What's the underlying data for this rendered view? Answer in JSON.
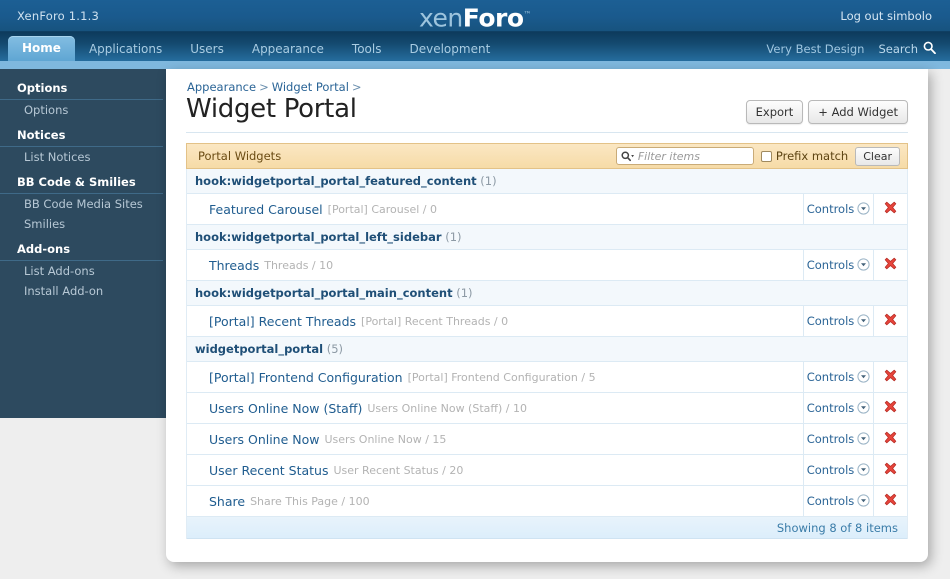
{
  "topbar": {
    "version": "XenForo 1.1.3",
    "logo_light": "xen",
    "logo_bold": "Foro",
    "logo_tm": "™",
    "logout": "Log out simbolo"
  },
  "nav": {
    "tabs": [
      {
        "label": "Home",
        "active": true
      },
      {
        "label": "Applications",
        "active": false
      },
      {
        "label": "Users",
        "active": false
      },
      {
        "label": "Appearance",
        "active": false
      },
      {
        "label": "Tools",
        "active": false
      },
      {
        "label": "Development",
        "active": false
      }
    ],
    "style_link": "Very Best Design",
    "search_label": "Search",
    "search_icon": "search-icon"
  },
  "sidebar": {
    "groups": [
      {
        "header": "Options",
        "items": [
          "Options"
        ]
      },
      {
        "header": "Notices",
        "items": [
          "List Notices"
        ]
      },
      {
        "header": "BB Code & Smilies",
        "items": [
          "BB Code Media Sites",
          "Smilies"
        ]
      },
      {
        "header": "Add-ons",
        "items": [
          "List Add-ons",
          "Install Add-on"
        ]
      }
    ]
  },
  "content": {
    "breadcrumb": [
      "Appearance",
      "Widget Portal"
    ],
    "breadcrumb_separator": ">",
    "page_title": "Widget Portal",
    "buttons": [
      "Export",
      "+ Add Widget"
    ]
  },
  "panel": {
    "title": "Portal Widgets",
    "filter_placeholder": "Filter items",
    "filter_value": "",
    "filter_icon": "search-dropdown-icon",
    "prefix_match_label": "Prefix match",
    "prefix_match_checked": false,
    "clear_label": "Clear"
  },
  "table": {
    "controls_label": "Controls",
    "delete_icon": "delete-x-icon",
    "dropdown_icon": "chevron-down-circle-icon",
    "groups": [
      {
        "name": "hook:widgetportal_portal_featured_content",
        "count": "(1)",
        "rows": [
          {
            "title": "Featured Carousel",
            "meta": "[Portal] Carousel / 0"
          }
        ]
      },
      {
        "name": "hook:widgetportal_portal_left_sidebar",
        "count": "(1)",
        "rows": [
          {
            "title": "Threads",
            "meta": "Threads / 10"
          }
        ]
      },
      {
        "name": "hook:widgetportal_portal_main_content",
        "count": "(1)",
        "rows": [
          {
            "title": "[Portal] Recent Threads",
            "meta": "[Portal] Recent Threads / 0"
          }
        ]
      },
      {
        "name": "widgetportal_portal",
        "count": "(5)",
        "rows": [
          {
            "title": "[Portal] Frontend Configuration",
            "meta": "[Portal] Frontend Configuration / 5"
          },
          {
            "title": "Users Online Now (Staff)",
            "meta": "Users Online Now (Staff) / 10"
          },
          {
            "title": "Users Online Now",
            "meta": "Users Online Now / 15"
          },
          {
            "title": "User Recent Status",
            "meta": "User Recent Status / 20"
          },
          {
            "title": "Share",
            "meta": "Share This Page / 100"
          }
        ]
      }
    ],
    "footer": "Showing 8 of 8 items"
  },
  "colors": {
    "topbar_blue": "#1a5a8d",
    "nav_dark": "#0d3a5c",
    "active_tab": "#6fb0d8",
    "strip_blue": "#7fb8de",
    "sidebar_slate": "#2d4a5f",
    "panel_orange": "#f6dba7",
    "link_blue": "#1f5c8f",
    "delete_red": "#e03b3b"
  }
}
